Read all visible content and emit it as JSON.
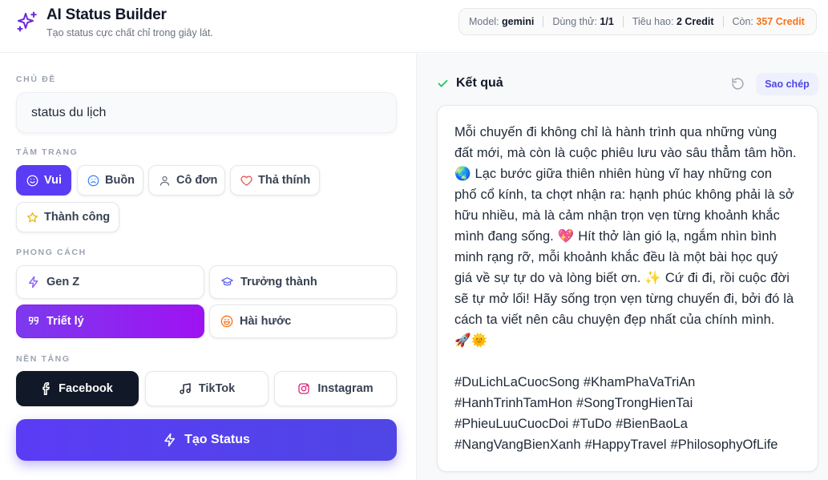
{
  "header": {
    "title": "AI Status Builder",
    "subtitle": "Tạo status cực chất chỉ trong giây lát.",
    "stats": {
      "model_label": "Model:",
      "model_value": "gemini",
      "trial_label": "Dùng thử:",
      "trial_value": "1/1",
      "cost_label": "Tiêu hao:",
      "cost_value": "2 Credit",
      "remain_label": "Còn:",
      "remain_value": "357 Credit"
    }
  },
  "form": {
    "topic_label": "CHỦ ĐỀ",
    "topic_value": "status du lịch",
    "mood_label": "TÂM TRẠNG",
    "moods": [
      {
        "label": "Vui",
        "icon": "smile-icon",
        "active": true
      },
      {
        "label": "Buồn",
        "icon": "sad-icon",
        "active": false
      },
      {
        "label": "Cô đơn",
        "icon": "user-icon",
        "active": false
      },
      {
        "label": "Thả thính",
        "icon": "heart-icon",
        "active": false
      },
      {
        "label": "Thành công",
        "icon": "star-icon",
        "active": false
      }
    ],
    "style_label": "PHONG CÁCH",
    "styles": [
      {
        "label": "Gen Z",
        "icon": "zap-icon",
        "active": false
      },
      {
        "label": "Trưởng thành",
        "icon": "graduation-cap-icon",
        "active": false
      },
      {
        "label": "Triết lý",
        "icon": "quote-icon",
        "active": true
      },
      {
        "label": "Hài hước",
        "icon": "laugh-icon",
        "active": false
      }
    ],
    "platform_label": "NỀN TẢNG",
    "platforms": [
      {
        "label": "Facebook",
        "icon": "facebook-icon",
        "active": true
      },
      {
        "label": "TikTok",
        "icon": "tiktok-icon",
        "active": false
      },
      {
        "label": "Instagram",
        "icon": "instagram-icon",
        "active": false
      }
    ],
    "generate_label": "Tạo Status"
  },
  "result": {
    "title": "Kết quả",
    "copy_label": "Sao chép",
    "text": "Mỗi chuyến đi không chỉ là hành trình qua những vùng\nđất mới, mà còn là cuộc phiêu lưu vào sâu thẳm tâm hồn.\n🌏 Lạc bước giữa thiên nhiên hùng vĩ hay những con\nphố cổ kính, ta chợt nhận ra: hạnh phúc không phải là sở\nhữu nhiều, mà là cảm nhận trọn vẹn từng khoảnh khắc\nmình đang sống. 💖 Hít thở làn gió lạ, ngắm nhìn bình\nminh rạng rỡ, mỗi khoảnh khắc đều là một bài học quý\ngiá về sự tự do và lòng biết ơn. ✨ Cứ đi đi, rồi cuộc đời\nsẽ tự mở lối! Hãy sống trọn vẹn từng chuyến đi, bởi đó là\ncách ta viết nên câu chuyện đẹp nhất của chính mình.\n🚀🌞\n\n#DuLichLaCuocSong #KhamPhaVaTriAn\n#HanhTrinhTamHon #SongTrongHienTai\n#PhieuLuuCuocDoi #TuDo #BienBaoLa\n#NangVangBienXanh #HappyTravel #PhilosophyOfLife"
  },
  "colors": {
    "primary": "#5b3cf5",
    "accent_purple": "#9f12f2",
    "dark": "#111827",
    "orange": "#f97316",
    "success": "#22c55e"
  }
}
